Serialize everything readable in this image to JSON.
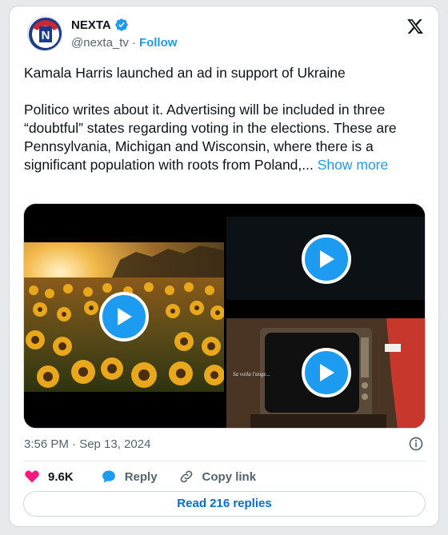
{
  "author": {
    "name": "NEXTA",
    "handle": "@nexta_tv",
    "separator": "·",
    "follow_label": "Follow",
    "avatar_letter": "N"
  },
  "tweet": {
    "text": "Kamala Harris launched an ad in support of Ukraine\n\nPolitico writes about it. Advertising will be included in three “doubtful” states regarding voting in the elections. These are Pennsylvania, Michigan and Wisconsin, where there is a significant population with roots from Poland,... ",
    "show_more_label": "Show more",
    "timestamp": "3:56 PM · Sep 13, 2024"
  },
  "media": {
    "tv_caption": "Sa voila l'ange..."
  },
  "actions": {
    "likes": "9.6K",
    "reply_label": "Reply",
    "copy_link_label": "Copy link"
  },
  "read_replies_label": "Read 216 replies",
  "colors": {
    "accent": "#1d9bf0",
    "like": "#f91880",
    "muted": "#536471",
    "text": "#0f1419"
  },
  "icons": [
    "verified-badge-icon",
    "x-logo-icon",
    "play-icon",
    "info-icon",
    "heart-icon",
    "reply-bubble-icon",
    "link-icon"
  ]
}
